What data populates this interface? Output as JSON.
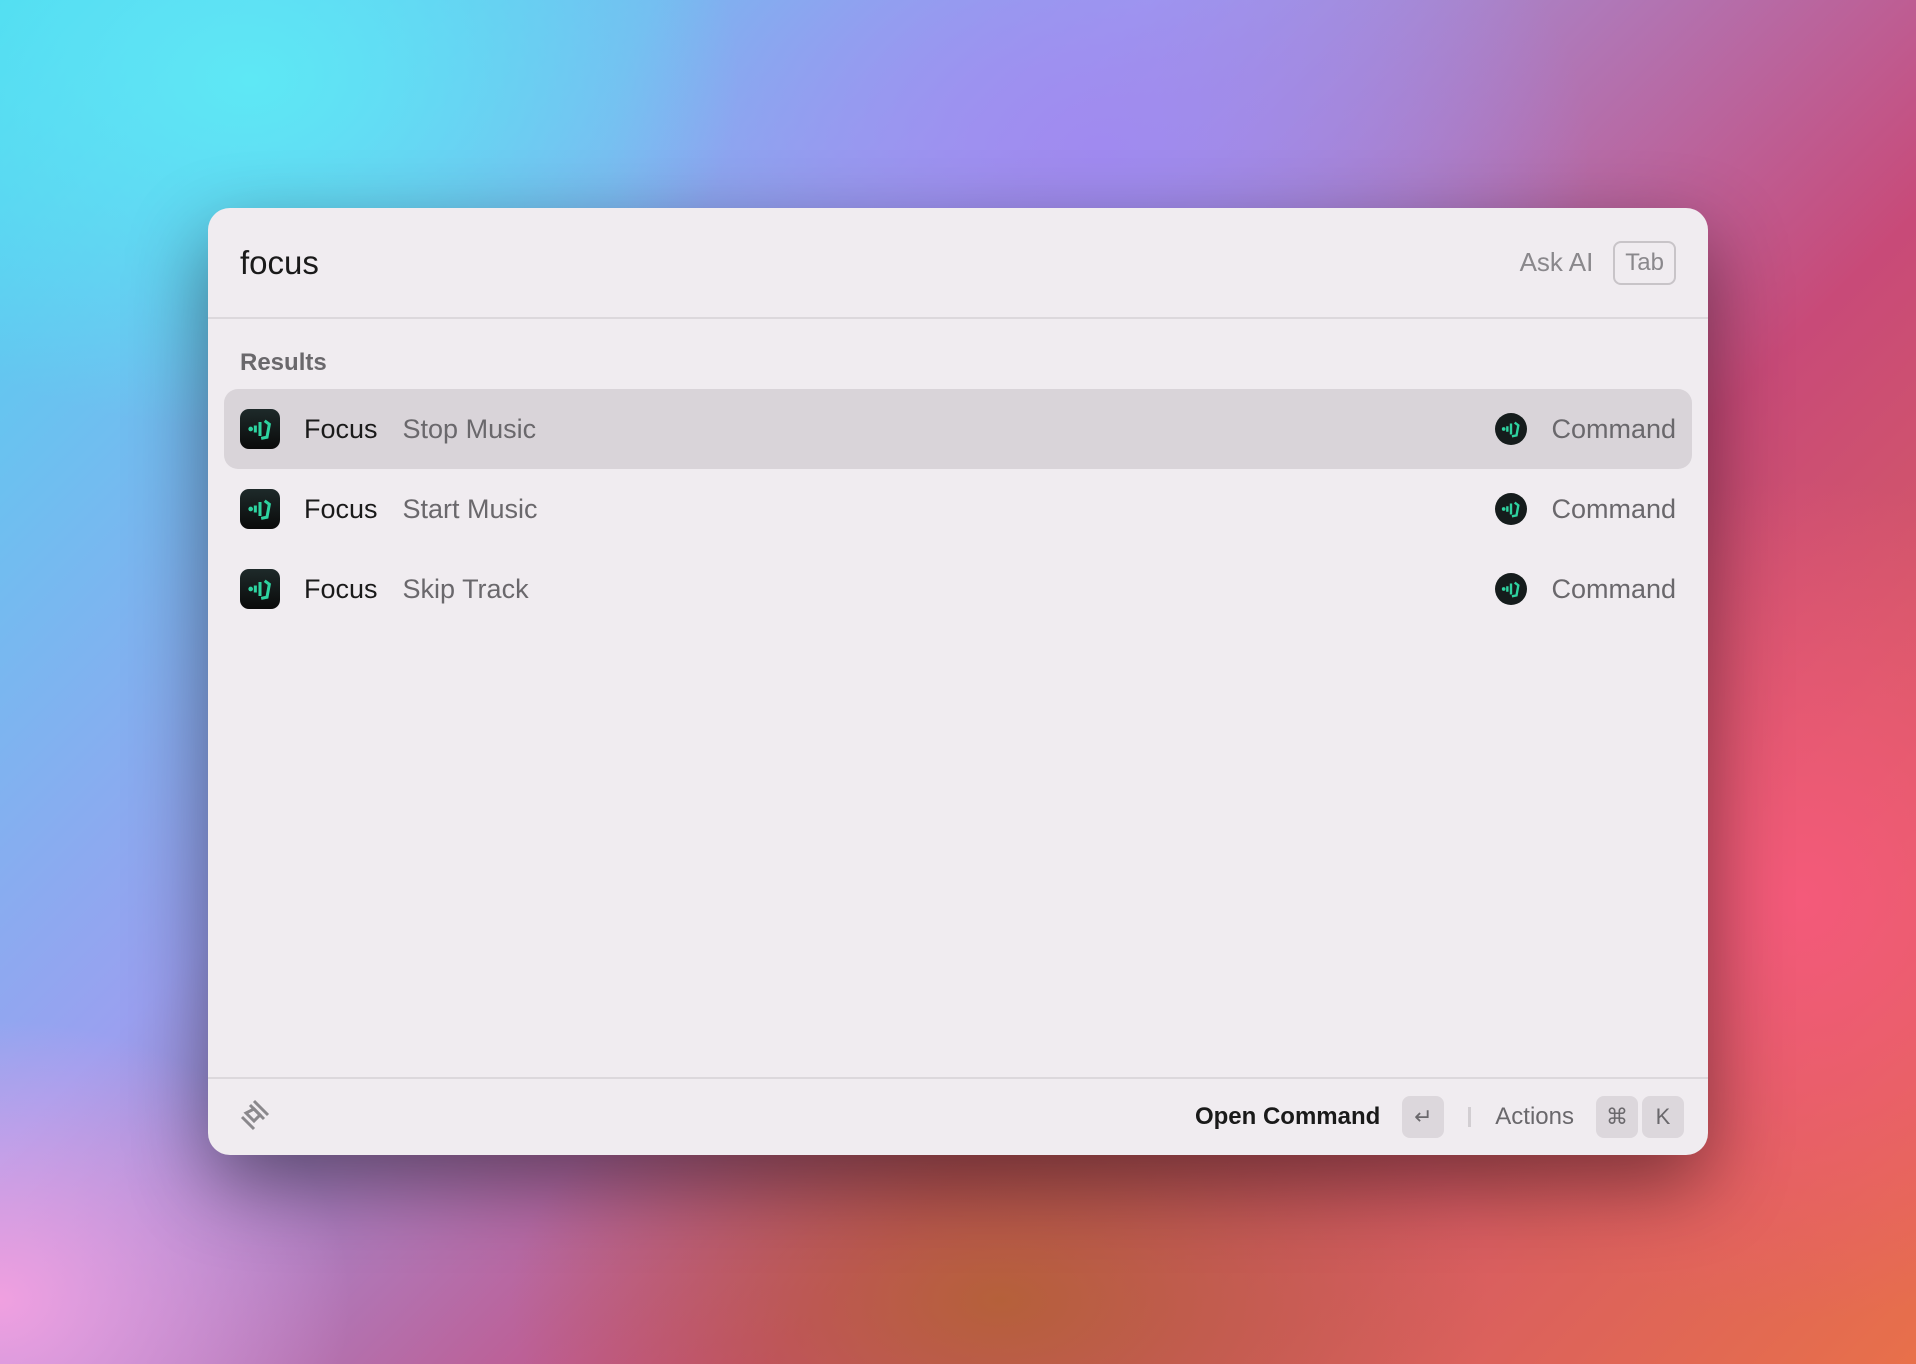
{
  "search": {
    "value": "focus",
    "ask_ai": "Ask AI",
    "tab_key": "Tab"
  },
  "section_label": "Results",
  "results": [
    {
      "title": "Focus",
      "subtitle": "Stop Music",
      "type": "Command",
      "selected": true,
      "icon": "focus-app-icon"
    },
    {
      "title": "Focus",
      "subtitle": "Start Music",
      "type": "Command",
      "selected": false,
      "icon": "focus-app-icon"
    },
    {
      "title": "Focus",
      "subtitle": "Skip Track",
      "type": "Command",
      "selected": false,
      "icon": "focus-app-icon"
    }
  ],
  "footer": {
    "logo": "raycast-logo-icon",
    "primary_action": "Open Command",
    "enter_key": "↵",
    "actions_label": "Actions",
    "cmd_key": "⌘",
    "k_key": "K"
  },
  "colors": {
    "accent": "#2ed3a0",
    "panel": "#f0ecf0",
    "selected_row": "#d9d4d9"
  }
}
